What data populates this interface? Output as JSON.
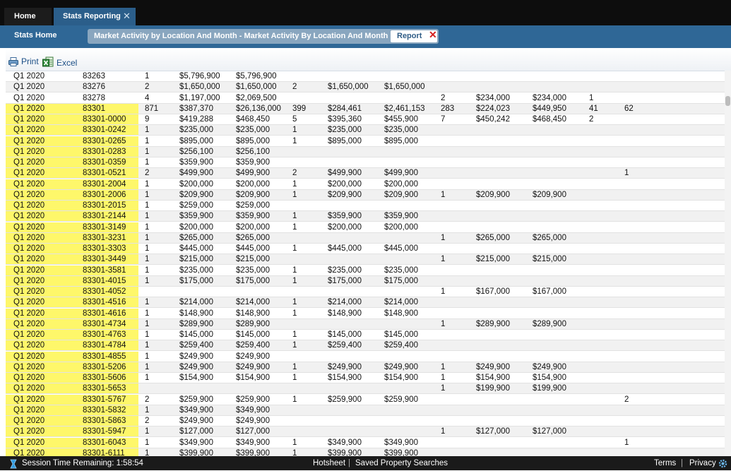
{
  "tabs": {
    "home": "Home",
    "stats": "Stats Reporting",
    "stats_close": "✕"
  },
  "subnav": {
    "stats_home": "Stats Home",
    "crumb": "Market Activity by Location And Month - Market Activity By Location And Month",
    "report_tab": "Report",
    "report_close": "✕"
  },
  "toolbar": {
    "print": "Print",
    "excel": "Excel"
  },
  "table": {
    "rows": [
      {
        "hl": false,
        "cells": [
          "Q1 2020",
          "83263",
          "1",
          "$5,796,900",
          "$5,796,900",
          "",
          "",
          "",
          "",
          "",
          "",
          "",
          ""
        ]
      },
      {
        "hl": false,
        "cells": [
          "Q1 2020",
          "83276",
          "2",
          "$1,650,000",
          "$1,650,000",
          "2",
          "$1,650,000",
          "$1,650,000",
          "",
          "",
          "",
          "",
          ""
        ]
      },
      {
        "hl": false,
        "cells": [
          "Q1 2020",
          "83278",
          "4",
          "$1,197,000",
          "$2,069,500",
          "",
          "",
          "",
          "2",
          "$234,000",
          "$234,000",
          "1",
          ""
        ]
      },
      {
        "hl": true,
        "cells": [
          "Q1 2020",
          "83301",
          "871",
          "$387,370",
          "$26,136,000",
          "399",
          "$284,461",
          "$2,461,153",
          "283",
          "$224,023",
          "$449,950",
          "41",
          "62"
        ]
      },
      {
        "hl": true,
        "cells": [
          "Q1 2020",
          "83301-0000",
          "9",
          "$419,288",
          "$468,450",
          "5",
          "$395,360",
          "$455,900",
          "7",
          "$450,242",
          "$468,450",
          "2",
          ""
        ]
      },
      {
        "hl": true,
        "cells": [
          "Q1 2020",
          "83301-0242",
          "1",
          "$235,000",
          "$235,000",
          "1",
          "$235,000",
          "$235,000",
          "",
          "",
          "",
          "",
          ""
        ]
      },
      {
        "hl": true,
        "cells": [
          "Q1 2020",
          "83301-0265",
          "1",
          "$895,000",
          "$895,000",
          "1",
          "$895,000",
          "$895,000",
          "",
          "",
          "",
          "",
          ""
        ]
      },
      {
        "hl": true,
        "cells": [
          "Q1 2020",
          "83301-0283",
          "1",
          "$256,100",
          "$256,100",
          "",
          "",
          "",
          "",
          "",
          "",
          "",
          ""
        ]
      },
      {
        "hl": true,
        "cells": [
          "Q1 2020",
          "83301-0359",
          "1",
          "$359,900",
          "$359,900",
          "",
          "",
          "",
          "",
          "",
          "",
          "",
          ""
        ]
      },
      {
        "hl": true,
        "cells": [
          "Q1 2020",
          "83301-0521",
          "2",
          "$499,900",
          "$499,900",
          "2",
          "$499,900",
          "$499,900",
          "",
          "",
          "",
          "",
          "1"
        ]
      },
      {
        "hl": true,
        "cells": [
          "Q1 2020",
          "83301-2004",
          "1",
          "$200,000",
          "$200,000",
          "1",
          "$200,000",
          "$200,000",
          "",
          "",
          "",
          "",
          ""
        ]
      },
      {
        "hl": true,
        "cells": [
          "Q1 2020",
          "83301-2006",
          "1",
          "$209,900",
          "$209,900",
          "1",
          "$209,900",
          "$209,900",
          "1",
          "$209,900",
          "$209,900",
          "",
          ""
        ]
      },
      {
        "hl": true,
        "cells": [
          "Q1 2020",
          "83301-2015",
          "1",
          "$259,000",
          "$259,000",
          "",
          "",
          "",
          "",
          "",
          "",
          "",
          ""
        ]
      },
      {
        "hl": true,
        "cells": [
          "Q1 2020",
          "83301-2144",
          "1",
          "$359,900",
          "$359,900",
          "1",
          "$359,900",
          "$359,900",
          "",
          "",
          "",
          "",
          ""
        ]
      },
      {
        "hl": true,
        "cells": [
          "Q1 2020",
          "83301-3149",
          "1",
          "$200,000",
          "$200,000",
          "1",
          "$200,000",
          "$200,000",
          "",
          "",
          "",
          "",
          ""
        ]
      },
      {
        "hl": true,
        "cells": [
          "Q1 2020",
          "83301-3231",
          "1",
          "$265,000",
          "$265,000",
          "",
          "",
          "",
          "1",
          "$265,000",
          "$265,000",
          "",
          ""
        ]
      },
      {
        "hl": true,
        "cells": [
          "Q1 2020",
          "83301-3303",
          "1",
          "$445,000",
          "$445,000",
          "1",
          "$445,000",
          "$445,000",
          "",
          "",
          "",
          "",
          ""
        ]
      },
      {
        "hl": true,
        "cells": [
          "Q1 2020",
          "83301-3449",
          "1",
          "$215,000",
          "$215,000",
          "",
          "",
          "",
          "1",
          "$215,000",
          "$215,000",
          "",
          ""
        ]
      },
      {
        "hl": true,
        "cells": [
          "Q1 2020",
          "83301-3581",
          "1",
          "$235,000",
          "$235,000",
          "1",
          "$235,000",
          "$235,000",
          "",
          "",
          "",
          "",
          ""
        ]
      },
      {
        "hl": true,
        "cells": [
          "Q1 2020",
          "83301-4015",
          "1",
          "$175,000",
          "$175,000",
          "1",
          "$175,000",
          "$175,000",
          "",
          "",
          "",
          "",
          ""
        ]
      },
      {
        "hl": true,
        "cells": [
          "Q1 2020",
          "83301-4052",
          "",
          "",
          "",
          "",
          "",
          "",
          "1",
          "$167,000",
          "$167,000",
          "",
          ""
        ]
      },
      {
        "hl": true,
        "cells": [
          "Q1 2020",
          "83301-4516",
          "1",
          "$214,000",
          "$214,000",
          "1",
          "$214,000",
          "$214,000",
          "",
          "",
          "",
          "",
          ""
        ]
      },
      {
        "hl": true,
        "cells": [
          "Q1 2020",
          "83301-4616",
          "1",
          "$148,900",
          "$148,900",
          "1",
          "$148,900",
          "$148,900",
          "",
          "",
          "",
          "",
          ""
        ]
      },
      {
        "hl": true,
        "cells": [
          "Q1 2020",
          "83301-4734",
          "1",
          "$289,900",
          "$289,900",
          "",
          "",
          "",
          "1",
          "$289,900",
          "$289,900",
          "",
          ""
        ]
      },
      {
        "hl": true,
        "cells": [
          "Q1 2020",
          "83301-4763",
          "1",
          "$145,000",
          "$145,000",
          "1",
          "$145,000",
          "$145,000",
          "",
          "",
          "",
          "",
          ""
        ]
      },
      {
        "hl": true,
        "cells": [
          "Q1 2020",
          "83301-4784",
          "1",
          "$259,400",
          "$259,400",
          "1",
          "$259,400",
          "$259,400",
          "",
          "",
          "",
          "",
          ""
        ]
      },
      {
        "hl": true,
        "cells": [
          "Q1 2020",
          "83301-4855",
          "1",
          "$249,900",
          "$249,900",
          "",
          "",
          "",
          "",
          "",
          "",
          "",
          ""
        ]
      },
      {
        "hl": true,
        "cells": [
          "Q1 2020",
          "83301-5206",
          "1",
          "$249,900",
          "$249,900",
          "1",
          "$249,900",
          "$249,900",
          "1",
          "$249,900",
          "$249,900",
          "",
          ""
        ]
      },
      {
        "hl": true,
        "cells": [
          "Q1 2020",
          "83301-5606",
          "1",
          "$154,900",
          "$154,900",
          "1",
          "$154,900",
          "$154,900",
          "1",
          "$154,900",
          "$154,900",
          "",
          ""
        ]
      },
      {
        "hl": true,
        "cells": [
          "Q1 2020",
          "83301-5653",
          "",
          "",
          "",
          "",
          "",
          "",
          "1",
          "$199,900",
          "$199,900",
          "",
          ""
        ]
      },
      {
        "hl": true,
        "cells": [
          "Q1 2020",
          "83301-5767",
          "2",
          "$259,900",
          "$259,900",
          "1",
          "$259,900",
          "$259,900",
          "",
          "",
          "",
          "",
          "2"
        ]
      },
      {
        "hl": true,
        "cells": [
          "Q1 2020",
          "83301-5832",
          "1",
          "$349,900",
          "$349,900",
          "",
          "",
          "",
          "",
          "",
          "",
          "",
          ""
        ]
      },
      {
        "hl": true,
        "cells": [
          "Q1 2020",
          "83301-5863",
          "2",
          "$249,900",
          "$249,900",
          "",
          "",
          "",
          "",
          "",
          "",
          "",
          ""
        ]
      },
      {
        "hl": true,
        "cells": [
          "Q1 2020",
          "83301-5947",
          "1",
          "$127,000",
          "$127,000",
          "",
          "",
          "",
          "1",
          "$127,000",
          "$127,000",
          "",
          ""
        ]
      },
      {
        "hl": true,
        "cells": [
          "Q1 2020",
          "83301-6043",
          "1",
          "$349,900",
          "$349,900",
          "1",
          "$349,900",
          "$349,900",
          "",
          "",
          "",
          "",
          "1"
        ]
      },
      {
        "hl": true,
        "cells": [
          "Q1 2020",
          "83301-6111",
          "1",
          "$399,900",
          "$399,900",
          "1",
          "$399,900",
          "$399,900",
          "",
          "",
          "",
          "",
          ""
        ]
      }
    ]
  },
  "footer": {
    "session": "Session Time Remaining: 1:58:54",
    "hotsheet": "Hotsheet",
    "sep": "|",
    "saved": "Saved Property Searches",
    "terms": "Terms",
    "privacy": "Privacy"
  },
  "colors": {
    "topbar": "#0d0d0d",
    "accent": "#2f6796",
    "highlight": "#fef76a",
    "footer": "#1a1a1a"
  },
  "icons": [
    "close-icon",
    "print-icon",
    "excel-icon",
    "session-icon",
    "gear-icon"
  ]
}
